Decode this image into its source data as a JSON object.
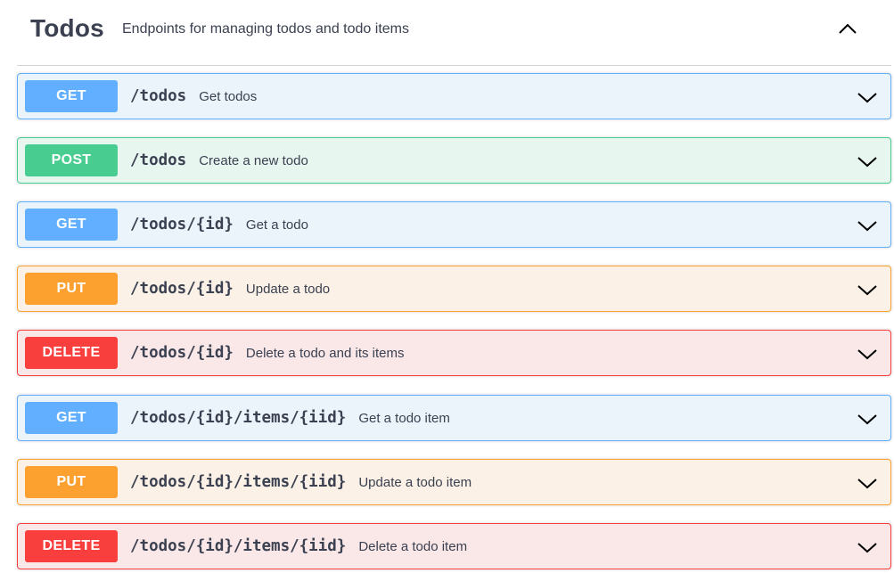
{
  "tag": {
    "title": "Todos",
    "description": "Endpoints for managing todos and todo items",
    "toggle_icon": "chevron-up-icon"
  },
  "operations": [
    {
      "method": "GET",
      "path": "/todos",
      "summary": "Get todos"
    },
    {
      "method": "POST",
      "path": "/todos",
      "summary": "Create a new todo"
    },
    {
      "method": "GET",
      "path": "/todos/{id}",
      "summary": "Get a todo"
    },
    {
      "method": "PUT",
      "path": "/todos/{id}",
      "summary": "Update a todo"
    },
    {
      "method": "DELETE",
      "path": "/todos/{id}",
      "summary": "Delete a todo and its items"
    },
    {
      "method": "GET",
      "path": "/todos/{id}/items/{iid}",
      "summary": "Get a todo item"
    },
    {
      "method": "PUT",
      "path": "/todos/{id}/items/{iid}",
      "summary": "Update a todo item"
    },
    {
      "method": "DELETE",
      "path": "/todos/{id}/items/{iid}",
      "summary": "Delete a todo item"
    }
  ],
  "colors": {
    "get": "#61affe",
    "post": "#49cc90",
    "put": "#fca130",
    "delete": "#f93e3e",
    "text": "#3b4151"
  },
  "icons": {
    "expand": "chevron-down-icon"
  }
}
